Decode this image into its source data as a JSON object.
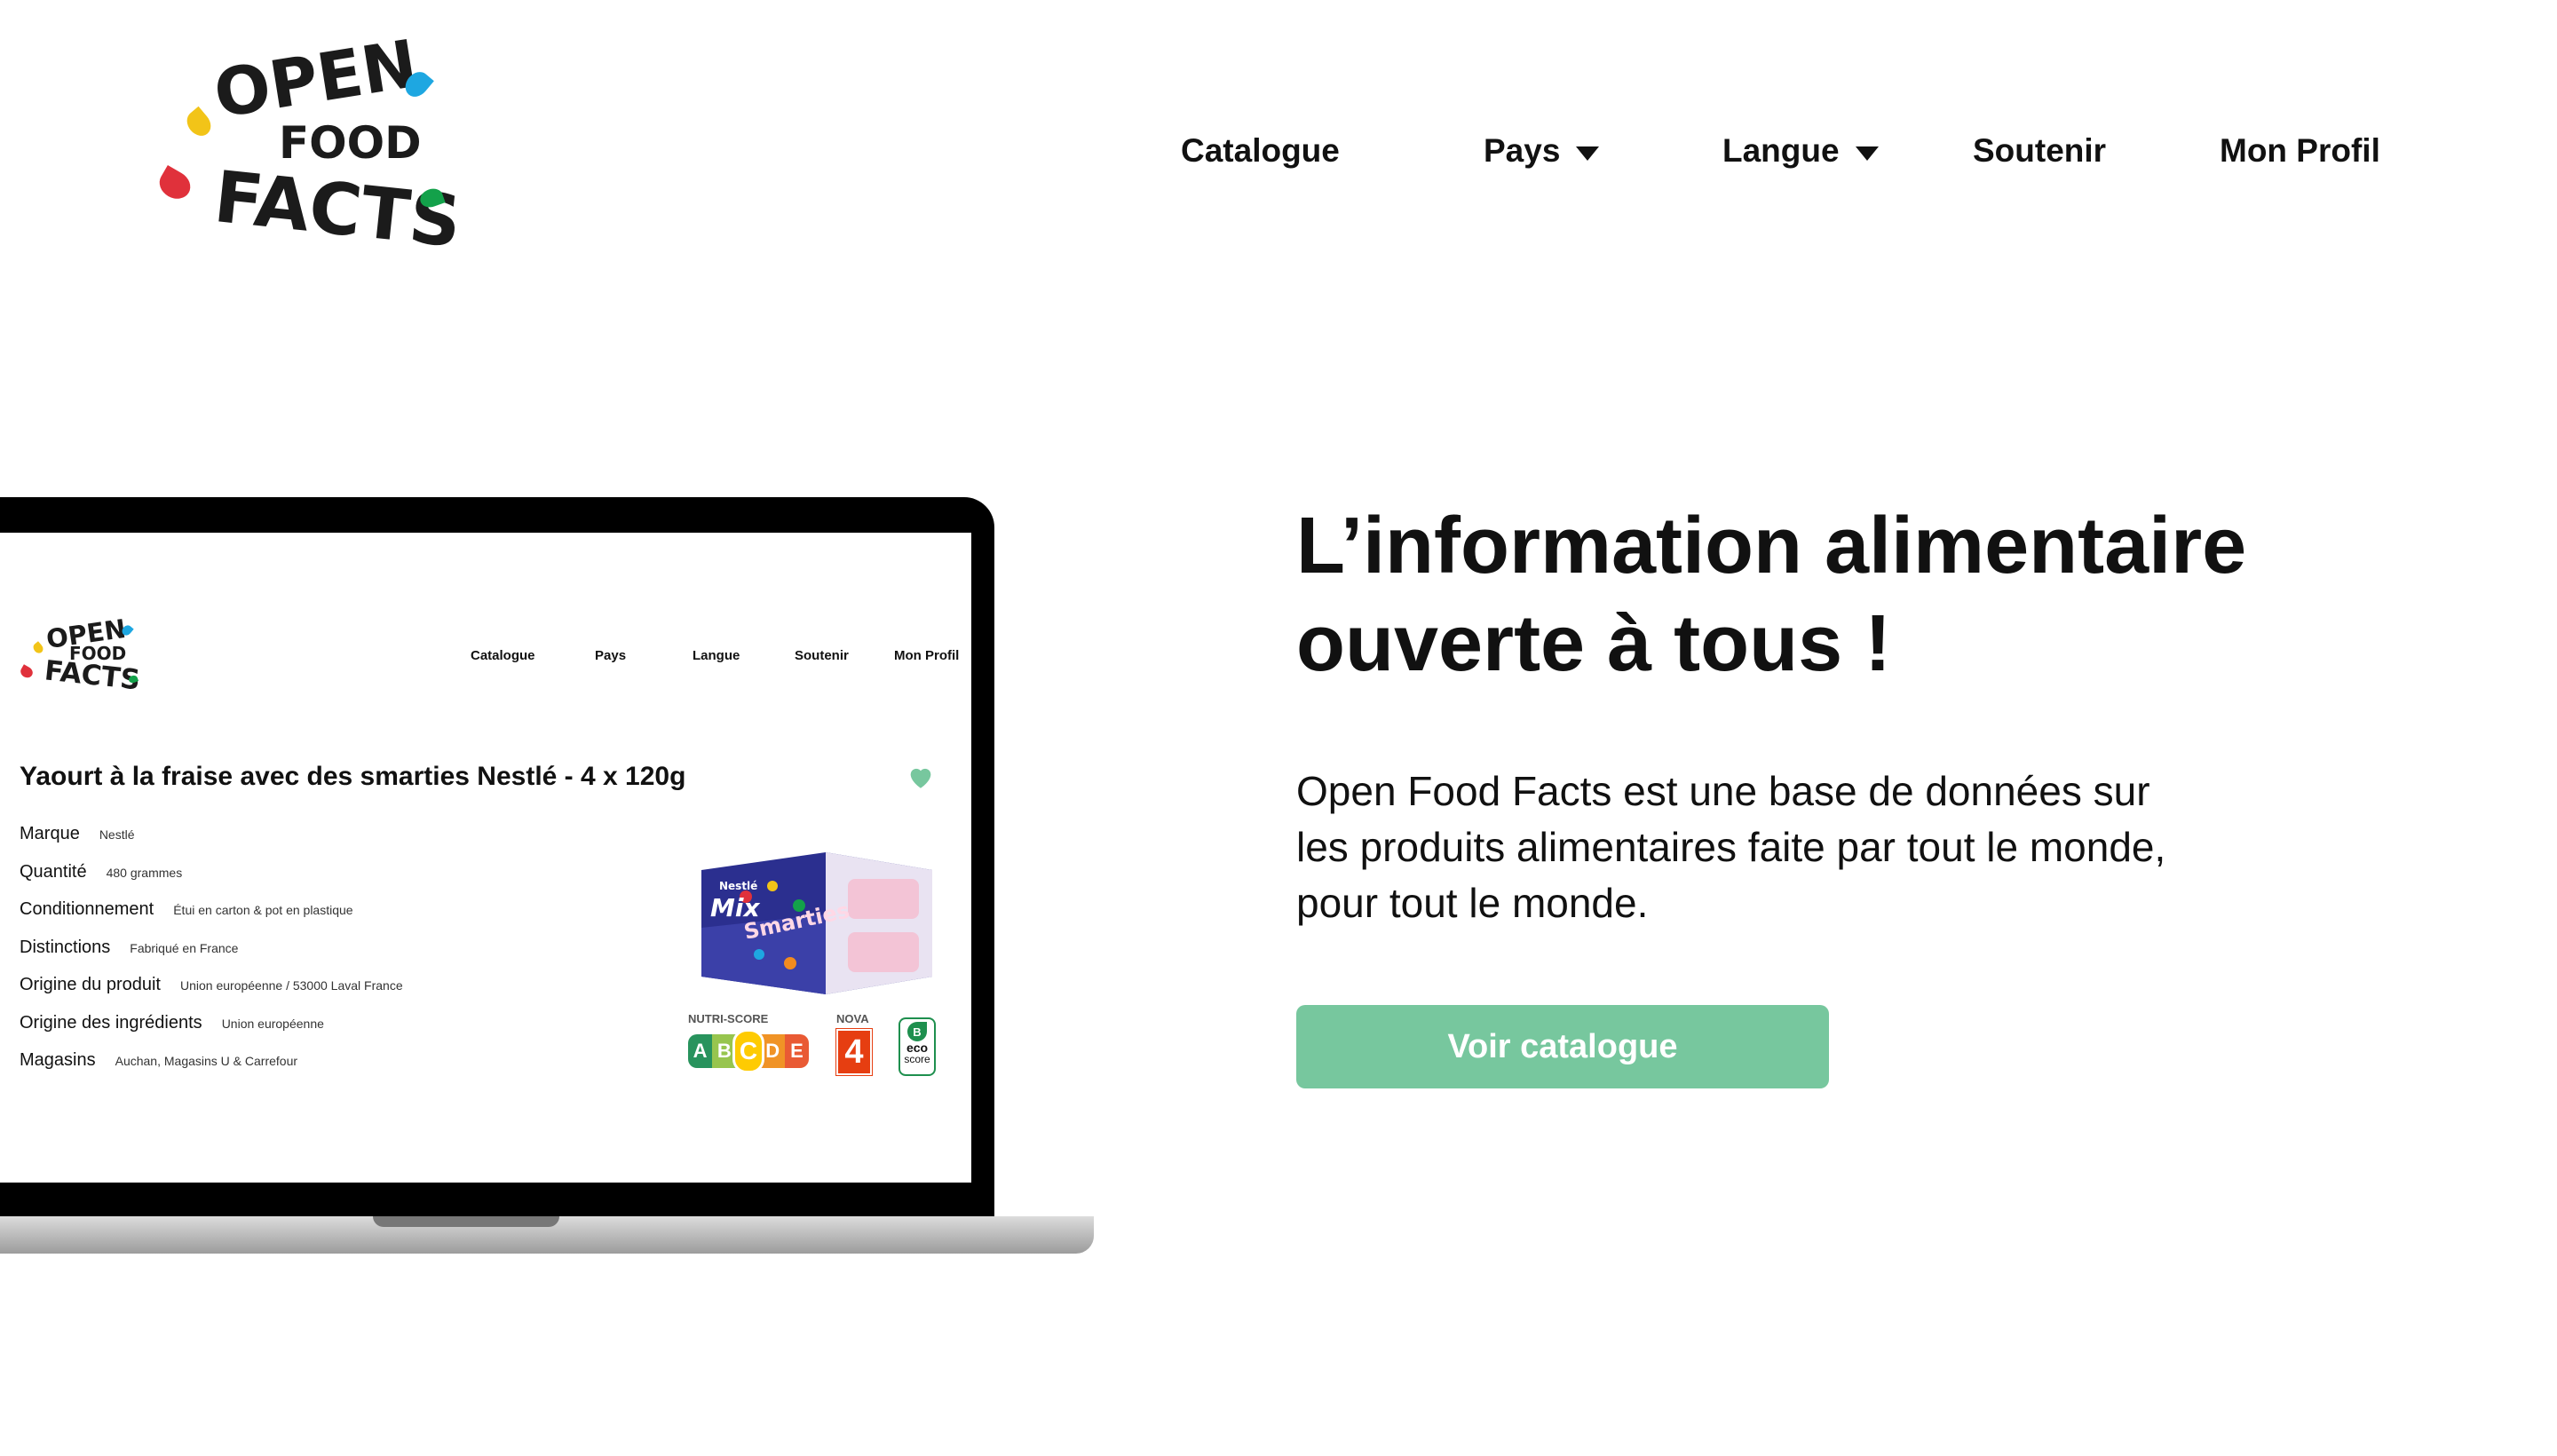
{
  "logo": {
    "line1": "OPEN",
    "line2": "FOOD",
    "line3": "FACTS"
  },
  "nav": {
    "catalogue": "Catalogue",
    "pays": "Pays",
    "langue": "Langue",
    "soutenir": "Soutenir",
    "profil": "Mon Profil"
  },
  "hero": {
    "title_line1": "L’information alimentaire",
    "title_line2": "ouverte à tous !",
    "text_line1": "Open Food Facts est une base de données sur",
    "text_line2": "les produits alimentaires faite par tout le monde,",
    "text_line3": "pour tout le monde.",
    "cta": "Voir catalogue"
  },
  "mockup": {
    "nav": {
      "catalogue": "Catalogue",
      "pays": "Pays",
      "langue": "Langue",
      "soutenir": "Soutenir",
      "profil": "Mon Profil"
    },
    "product_title": "Yaourt à la fraise avec des smarties Nestlé - 4 x 120g",
    "details": [
      {
        "label": "Marque",
        "value": "Nestlé"
      },
      {
        "label": "Quantité",
        "value": "480 grammes"
      },
      {
        "label": "Conditionnement",
        "value": "Étui en carton & pot en plastique"
      },
      {
        "label": "Distinctions",
        "value": "Fabriqué en France"
      },
      {
        "label": "Origine du produit",
        "value": "Union européenne / 53000 Laval France"
      },
      {
        "label": "Origine des ingrédients",
        "value": "Union européenne"
      },
      {
        "label": "Magasins",
        "value": "Auchan, Magasins U & Carrefour"
      }
    ],
    "nutriscore": {
      "label": "NUTRI-SCORE",
      "grades": [
        "A",
        "B",
        "C",
        "D",
        "E"
      ],
      "selected": "C"
    },
    "nova": {
      "label": "NOVA",
      "value": "4"
    },
    "ecoscore": {
      "grade": "B",
      "word1": "eco",
      "word2": "score"
    },
    "product_art": {
      "brand": "Nestlé",
      "line1": "Mix",
      "line2": "Smarties"
    }
  },
  "colors": {
    "accent": "#77c79e",
    "logo_yellow": "#f2c418",
    "logo_blue": "#1ea7e1",
    "logo_red": "#e0313b",
    "logo_green": "#13a14a"
  }
}
